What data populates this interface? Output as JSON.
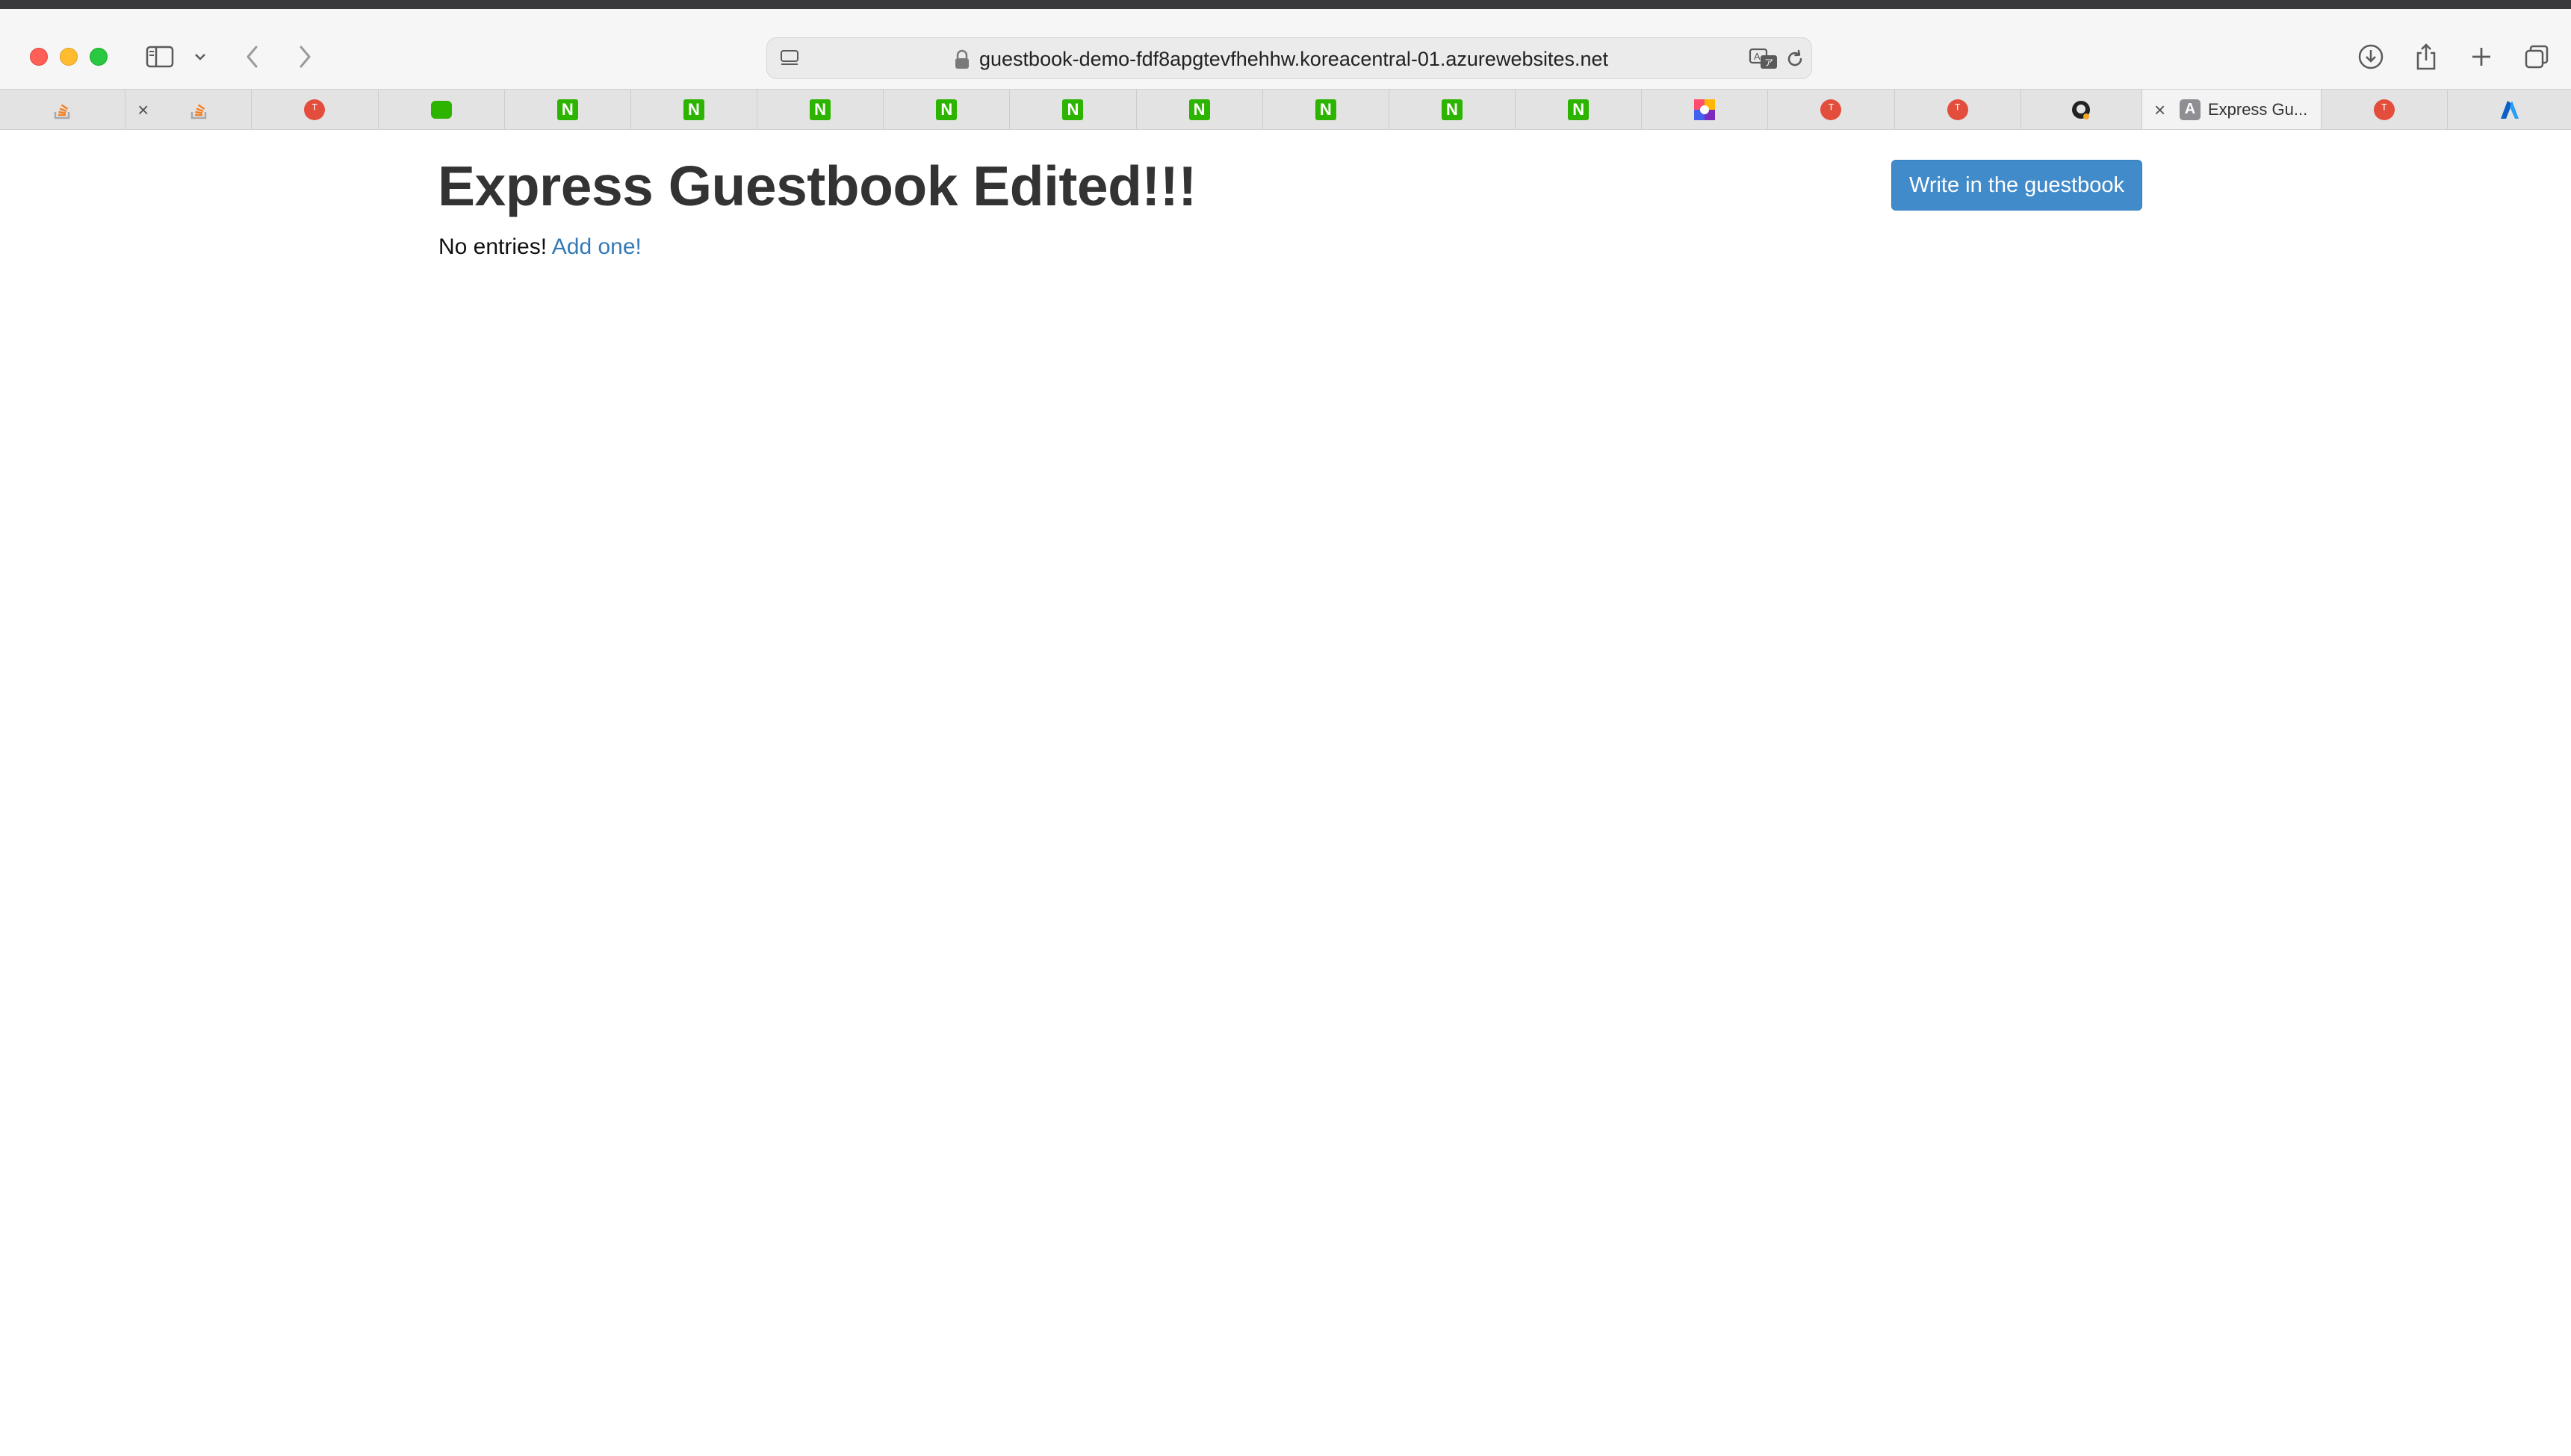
{
  "browser": {
    "url": "guestbook-demo-fdf8apgtevfhehhw.koreacentral-01.azurewebsites.net",
    "tabs": [
      {
        "favicon": "stackoverflow-icon"
      },
      {
        "favicon": "stackoverflow-icon",
        "closable": true
      },
      {
        "favicon": "red-circle-icon"
      },
      {
        "favicon": "chat-icon"
      },
      {
        "favicon": "naver-icon",
        "glyph": "N"
      },
      {
        "favicon": "naver-icon",
        "glyph": "N"
      },
      {
        "favicon": "naver-icon",
        "glyph": "N"
      },
      {
        "favicon": "naver-icon",
        "glyph": "N"
      },
      {
        "favicon": "naver-icon",
        "glyph": "N"
      },
      {
        "favicon": "naver-icon",
        "glyph": "N"
      },
      {
        "favicon": "naver-icon",
        "glyph": "N"
      },
      {
        "favicon": "naver-icon",
        "glyph": "N"
      },
      {
        "favicon": "naver-icon",
        "glyph": "N"
      },
      {
        "favicon": "colorful-app-icon"
      },
      {
        "favicon": "red-circle-icon"
      },
      {
        "favicon": "red-circle-icon"
      },
      {
        "favicon": "github-icon"
      },
      {
        "favicon": "letter-a-icon",
        "glyph": "A",
        "title": "Express Gu...",
        "active": true
      },
      {
        "favicon": "red-circle-icon"
      },
      {
        "favicon": "azure-icon"
      }
    ]
  },
  "page": {
    "title": "Express Guestbook Edited!!!",
    "empty_text": "No entries!",
    "add_link": "Add one!",
    "write_button": "Write in the guestbook"
  },
  "colors": {
    "button": "#428bca",
    "link": "#337ab7",
    "naver_green": "#2db400",
    "red_favicon": "#e34d3c"
  }
}
